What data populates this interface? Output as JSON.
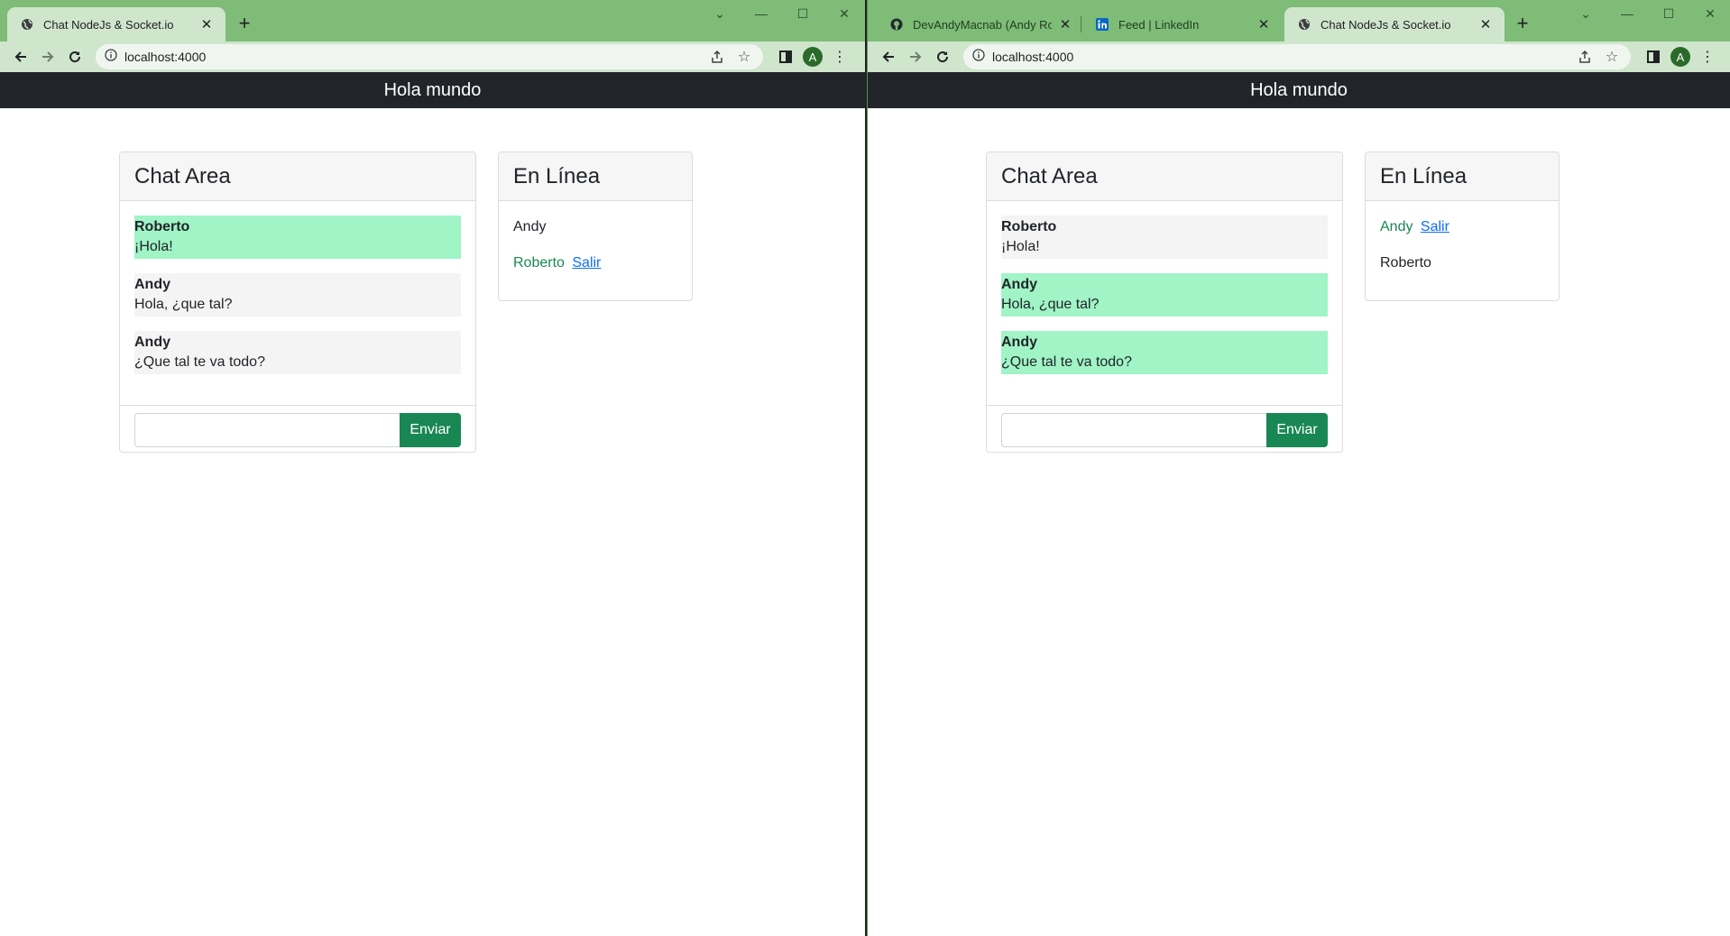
{
  "colors": {
    "tabstrip": "#7ebc78",
    "toolbar": "#cfe6cc",
    "navbar": "#212529",
    "own_message": "#a0f4c6",
    "other_message": "#f4f4f4",
    "send_button": "#198754",
    "link": "#0d6efd",
    "current_user": "#198754"
  },
  "left": {
    "tabs": [
      {
        "title": "Chat NodeJs & Socket.io",
        "icon": "globe-icon",
        "active": true
      }
    ],
    "url": "localhost:4000",
    "avatar": "A",
    "header_title": "Hola mundo",
    "chat_title": "Chat Area",
    "messages": [
      {
        "author": "Roberto",
        "text": "¡Hola!",
        "mine": true
      },
      {
        "author": "Andy",
        "text": "Hola, ¿que tal?",
        "mine": false
      },
      {
        "author": "Andy",
        "text": "¿Que tal te va todo?",
        "mine": false
      }
    ],
    "input_value": "",
    "send_label": "Enviar",
    "online_title": "En Línea",
    "users": [
      {
        "name": "Andy",
        "me": false,
        "logout": ""
      },
      {
        "name": "Roberto",
        "me": true,
        "logout": "Salir"
      }
    ]
  },
  "right": {
    "tabs": [
      {
        "title": "DevAndyMacnab (Andy Roberto",
        "icon": "github-icon",
        "active": false
      },
      {
        "title": "Feed | LinkedIn",
        "icon": "linkedin-icon",
        "active": false
      },
      {
        "title": "Chat NodeJs & Socket.io",
        "icon": "globe-icon",
        "active": true
      }
    ],
    "url": "localhost:4000",
    "avatar": "A",
    "header_title": "Hola mundo",
    "chat_title": "Chat Area",
    "messages": [
      {
        "author": "Roberto",
        "text": "¡Hola!",
        "mine": false
      },
      {
        "author": "Andy",
        "text": "Hola, ¿que tal?",
        "mine": true
      },
      {
        "author": "Andy",
        "text": "¿Que tal te va todo?",
        "mine": true
      }
    ],
    "input_value": "",
    "send_label": "Enviar",
    "online_title": "En Línea",
    "users": [
      {
        "name": "Andy",
        "me": true,
        "logout": "Salir"
      },
      {
        "name": "Roberto",
        "me": false,
        "logout": ""
      }
    ]
  }
}
